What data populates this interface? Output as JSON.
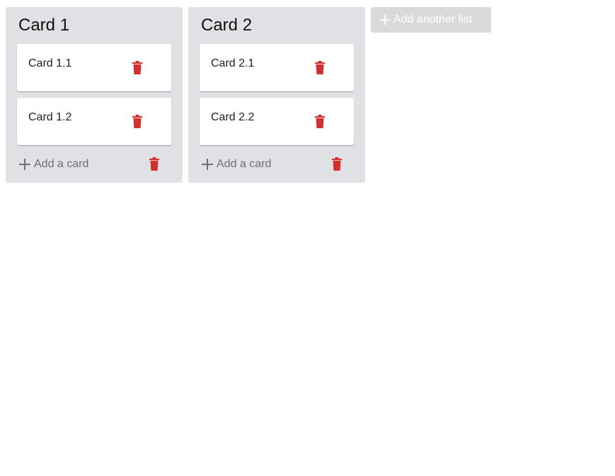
{
  "lists": [
    {
      "title": "Card 1",
      "cards": [
        {
          "text": "Card 1.1"
        },
        {
          "text": "Card 1.2"
        }
      ],
      "add_card_label": "Add a card"
    },
    {
      "title": "Card 2",
      "cards": [
        {
          "text": "Card 2.1"
        },
        {
          "text": "Card 2.2"
        }
      ],
      "add_card_label": "Add a card"
    }
  ],
  "add_list_label": "Add another list",
  "colors": {
    "list_bg": "#dfe1e4",
    "trash": "#d32f2f",
    "add_list_bg": "#dadada"
  },
  "icons": {
    "delete": "trash-icon",
    "add": "plus-icon"
  }
}
